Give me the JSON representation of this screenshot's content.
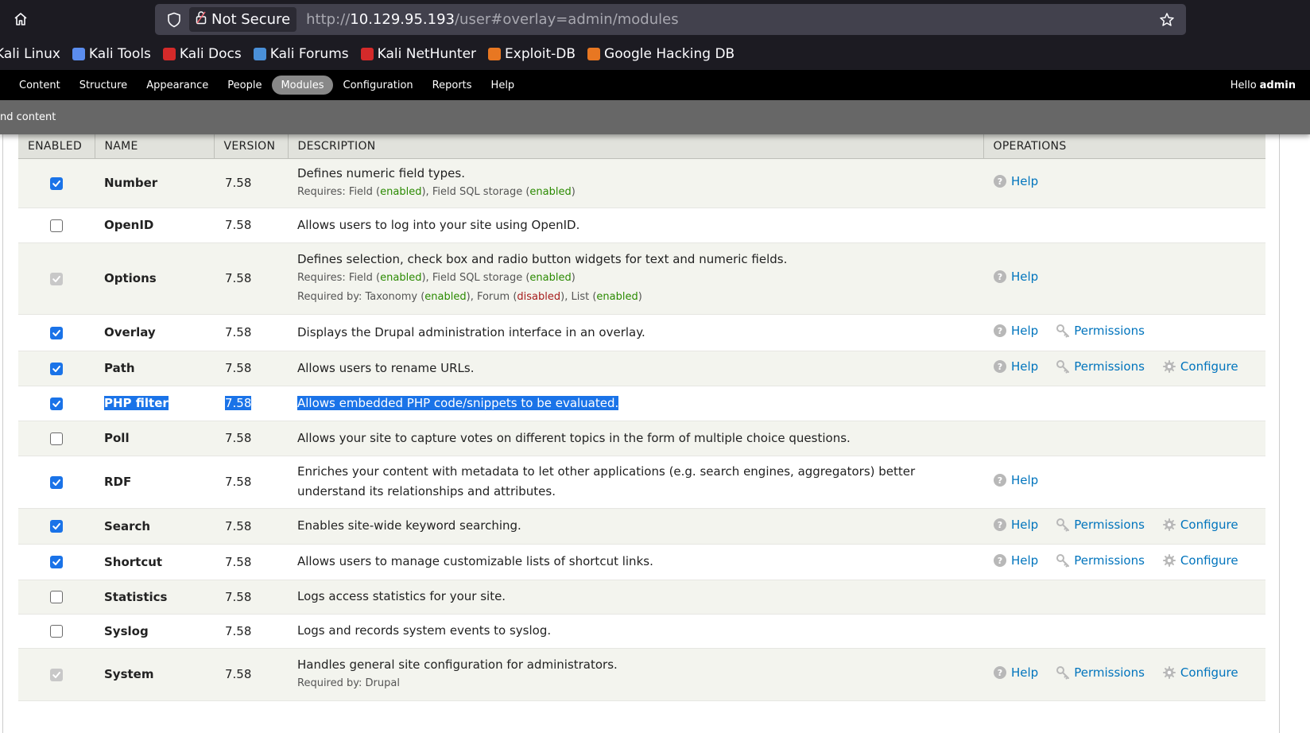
{
  "browser": {
    "security_label": "Not Secure",
    "url_prefix": "http://",
    "url_host": "10.129.95.193",
    "url_path": "/user#overlay=admin/modules"
  },
  "bookmarks": [
    {
      "label": "Kali Linux",
      "color": "#367bf0"
    },
    {
      "label": "Kali Tools",
      "color": "#5b8def"
    },
    {
      "label": "Kali Docs",
      "color": "#d42a2a"
    },
    {
      "label": "Kali Forums",
      "color": "#4a90d9"
    },
    {
      "label": "Kali NetHunter",
      "color": "#d42a2a"
    },
    {
      "label": "Exploit-DB",
      "color": "#e87722"
    },
    {
      "label": "Google Hacking DB",
      "color": "#e87722"
    }
  ],
  "toolbar": {
    "items": [
      "Content",
      "Structure",
      "Appearance",
      "People",
      "Modules",
      "Configuration",
      "Reports",
      "Help"
    ],
    "active": "Modules",
    "hello": "Hello",
    "user": "admin"
  },
  "shortcuts": {
    "label": "nd content"
  },
  "table": {
    "headers": {
      "enabled": "ENABLED",
      "name": "NAME",
      "version": "VERSION",
      "description": "DESCRIPTION",
      "operations": "OPERATIONS"
    },
    "ops_labels": {
      "help": "Help",
      "permissions": "Permissions",
      "configure": "Configure"
    },
    "requires_label": "Requires:",
    "required_by_label": "Required by:",
    "rows": [
      {
        "name": "Number",
        "version": "7.58",
        "state": "on",
        "description": "Defines numeric field types.",
        "requires": [
          {
            "name": "Field",
            "status": "enabled"
          },
          {
            "name": "Field SQL storage",
            "status": "enabled"
          }
        ],
        "required_by": [],
        "required_by_text": "",
        "ops": [
          "help"
        ]
      },
      {
        "name": "OpenID",
        "version": "7.58",
        "state": "off",
        "description": "Allows users to log into your site using OpenID.",
        "requires": [],
        "required_by": [],
        "required_by_text": "",
        "ops": []
      },
      {
        "name": "Options",
        "version": "7.58",
        "state": "dis",
        "description": "Defines selection, check box and radio button widgets for text and numeric fields.",
        "requires": [
          {
            "name": "Field",
            "status": "enabled"
          },
          {
            "name": "Field SQL storage",
            "status": "enabled"
          }
        ],
        "required_by": [
          {
            "name": "Taxonomy",
            "status": "enabled"
          },
          {
            "name": "Forum",
            "status": "disabled"
          },
          {
            "name": "List",
            "status": "enabled"
          }
        ],
        "required_by_text": "",
        "ops": [
          "help"
        ]
      },
      {
        "name": "Overlay",
        "version": "7.58",
        "state": "on",
        "description": "Displays the Drupal administration interface in an overlay.",
        "requires": [],
        "required_by": [],
        "required_by_text": "",
        "ops": [
          "help",
          "permissions"
        ]
      },
      {
        "name": "Path",
        "version": "7.58",
        "state": "on",
        "description": "Allows users to rename URLs.",
        "requires": [],
        "required_by": [],
        "required_by_text": "",
        "ops": [
          "help",
          "permissions",
          "configure"
        ]
      },
      {
        "name": "PHP filter",
        "version": "7.58",
        "state": "on",
        "description": "Allows embedded PHP code/snippets to be evaluated.",
        "selected": true,
        "requires": [],
        "required_by": [],
        "required_by_text": "",
        "ops": []
      },
      {
        "name": "Poll",
        "version": "7.58",
        "state": "off",
        "description": "Allows your site to capture votes on different topics in the form of multiple choice questions.",
        "requires": [],
        "required_by": [],
        "required_by_text": "",
        "ops": []
      },
      {
        "name": "RDF",
        "version": "7.58",
        "state": "on",
        "description": "Enriches your content with metadata to let other applications (e.g. search engines, aggregators) better understand its relationships and attributes.",
        "requires": [],
        "required_by": [],
        "required_by_text": "",
        "ops": [
          "help"
        ]
      },
      {
        "name": "Search",
        "version": "7.58",
        "state": "on",
        "description": "Enables site-wide keyword searching.",
        "requires": [],
        "required_by": [],
        "required_by_text": "",
        "ops": [
          "help",
          "permissions",
          "configure"
        ]
      },
      {
        "name": "Shortcut",
        "version": "7.58",
        "state": "on",
        "description": "Allows users to manage customizable lists of shortcut links.",
        "requires": [],
        "required_by": [],
        "required_by_text": "",
        "ops": [
          "help",
          "permissions",
          "configure"
        ]
      },
      {
        "name": "Statistics",
        "version": "7.58",
        "state": "off",
        "description": "Logs access statistics for your site.",
        "requires": [],
        "required_by": [],
        "required_by_text": "",
        "ops": []
      },
      {
        "name": "Syslog",
        "version": "7.58",
        "state": "off",
        "description": "Logs and records system events to syslog.",
        "requires": [],
        "required_by": [],
        "required_by_text": "",
        "ops": []
      },
      {
        "name": "System",
        "version": "7.58",
        "state": "dis",
        "description": "Handles general site configuration for administrators.",
        "requires": [],
        "required_by": [],
        "required_by_text": "Drupal",
        "ops": [
          "help",
          "permissions",
          "configure"
        ]
      }
    ]
  }
}
